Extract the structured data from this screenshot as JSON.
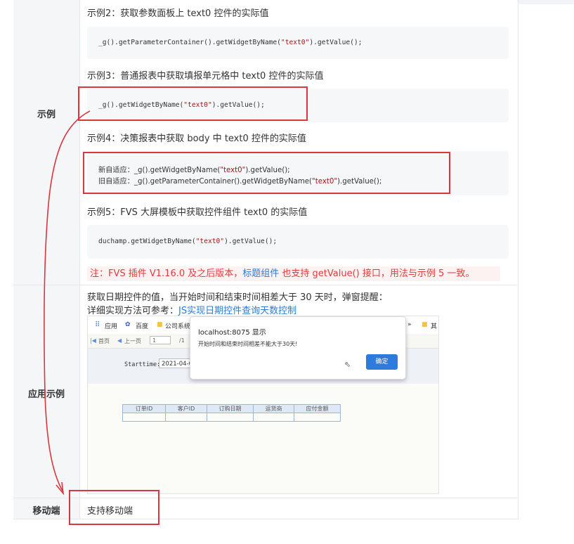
{
  "rows": {
    "example_label": "示例",
    "app_label": "应用示例",
    "mobile_label": "移动端"
  },
  "examples": {
    "ex2_title": "示例2：获取参数面板上 text0 控件的实际值",
    "ex2_code_a": "_g().getParameterContainer().getWidgetByName(",
    "ex2_code_str": "\"text0\"",
    "ex2_code_b": ").getValue();",
    "ex3_title": "示例3：普通报表中获取填报单元格中 text0 控件的实际值",
    "ex3_code_a": "_g().getWidgetByName(",
    "ex3_code_str": "\"text0\"",
    "ex3_code_b": ").getValue();",
    "ex4_title": "示例4：决策报表中获取 body 中 text0 控件的实际值",
    "ex4_line1_a": "新自适应：_g().getWidgetByName(",
    "ex4_line1_str": "\"text0\"",
    "ex4_line1_b": ").getValue();",
    "ex4_line2_a": "旧自适应：_g().getParameterContainer().getWidgetByName(",
    "ex4_line2_str": "\"text0\"",
    "ex4_line2_b": ").getValue();",
    "ex5_title": "示例5：FVS 大屏模板中获取控件组件 text0 的实际值",
    "ex5_code_a": "duchamp.getWidgetByName(",
    "ex5_code_str": "\"text0\"",
    "ex5_code_b": ").getValue();"
  },
  "note": {
    "prefix": "注：FVS 插件 V1.16.0 及之后版本，",
    "link": "标题组件",
    "suffix": " 也支持 getValue() 接口，用法与示例 5 一致。"
  },
  "app": {
    "line1": "获取日期控件的值，当开始时间和结束时间相差大于 30 天时，弹窗提醒：",
    "line2_prefix": "详细实现方法可参考：",
    "line2_link": "JS实现日期控件查询天数控制"
  },
  "screenshot": {
    "bookmarks": [
      "应用",
      "百度",
      "公司系统",
      "»",
      "其"
    ],
    "pager_first": "首页",
    "pager_prev": "上一页",
    "pager_page": "1",
    "pager_total": "/1",
    "param_label": "Starttime:",
    "param_value": "2021-04-05",
    "dialog_title": "localhost:8075 显示",
    "dialog_message": "开始时间和结束时间相差不能大于30天!",
    "dialog_button": "确定",
    "columns": [
      "订单ID",
      "客户ID",
      "订购日期",
      "运货商",
      "应付金额"
    ]
  },
  "mobile": {
    "text": "支持移动端"
  },
  "colors": {
    "annotation_red": "#d9363e",
    "link_blue": "#2b7cd3",
    "note_red": "#e4393c"
  }
}
